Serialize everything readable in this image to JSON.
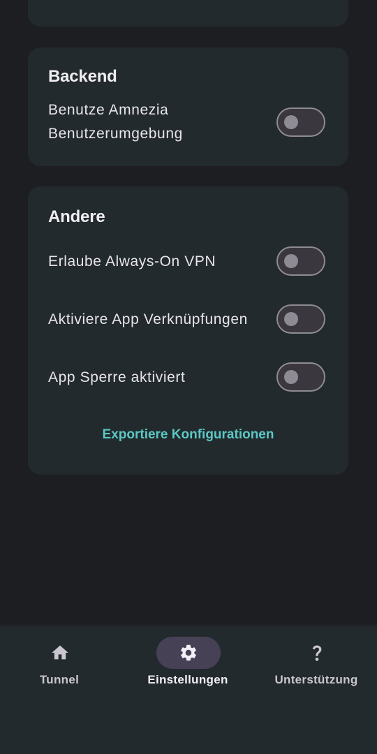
{
  "sections": {
    "backend": {
      "title": "Backend",
      "settings": [
        {
          "label_line1": "Benutze Amnezia",
          "label_line2": "Benutzerumgebung",
          "enabled": false
        }
      ]
    },
    "other": {
      "title": "Andere",
      "settings": [
        {
          "label": "Erlaube Always-On VPN",
          "enabled": false
        },
        {
          "label": "Aktiviere App Verknüpfungen",
          "enabled": false
        },
        {
          "label": "App Sperre aktiviert",
          "enabled": false
        }
      ],
      "export_label": "Exportiere Konfigurationen"
    }
  },
  "bottom_nav": {
    "items": [
      {
        "label": "Tunnel",
        "icon": "home-icon",
        "active": false
      },
      {
        "label": "Einstellungen",
        "icon": "gear-icon",
        "active": true
      },
      {
        "label": "Unterstützung",
        "icon": "question-icon",
        "active": false
      }
    ]
  },
  "colors": {
    "background": "#1d1e22",
    "card": "#222a2e",
    "accent": "#5cc8c3",
    "active_pill": "#474156",
    "toggle_border": "#8e8b94"
  }
}
